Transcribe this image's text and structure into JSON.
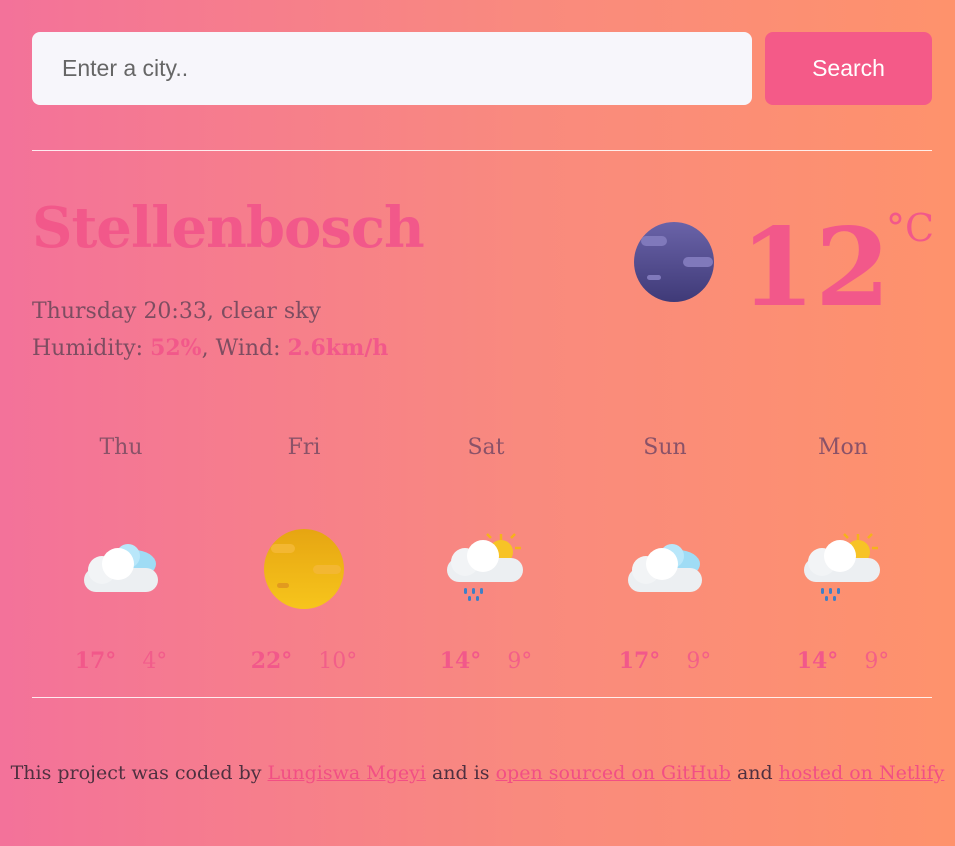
{
  "search": {
    "placeholder": "Enter a city..",
    "value": "",
    "button_label": "Search"
  },
  "current": {
    "city": "Stellenbosch",
    "day_time": "Thursday 20:33",
    "description": "clear sky",
    "humidity_label": "Humidity:",
    "humidity": "52%",
    "wind_label": "Wind:",
    "wind": "2.6km/h",
    "temperature": "12",
    "unit": "°C",
    "icon": "moon-clear-night-icon"
  },
  "forecast": [
    {
      "day": "Thu",
      "icon": "partly-cloudy-icon",
      "max": "17°",
      "min": "4°"
    },
    {
      "day": "Fri",
      "icon": "sun-icon",
      "max": "22°",
      "min": "10°"
    },
    {
      "day": "Sat",
      "icon": "sun-cloud-rain-icon",
      "max": "14°",
      "min": "9°"
    },
    {
      "day": "Sun",
      "icon": "partly-cloudy-icon",
      "max": "17°",
      "min": "9°"
    },
    {
      "day": "Mon",
      "icon": "sun-cloud-rain-icon",
      "max": "14°",
      "min": "9°"
    }
  ],
  "footer": {
    "prefix": "This project was coded by",
    "author_link": "Lungiswa Mgeyi",
    "middle": "and is",
    "github_link": "open sourced on GitHub",
    "and": "and",
    "netlify_link": "hosted on Netlify"
  },
  "colors": {
    "accent": "#f45a88",
    "text": "#7a4b60",
    "input_bg": "#f7f6fb"
  }
}
